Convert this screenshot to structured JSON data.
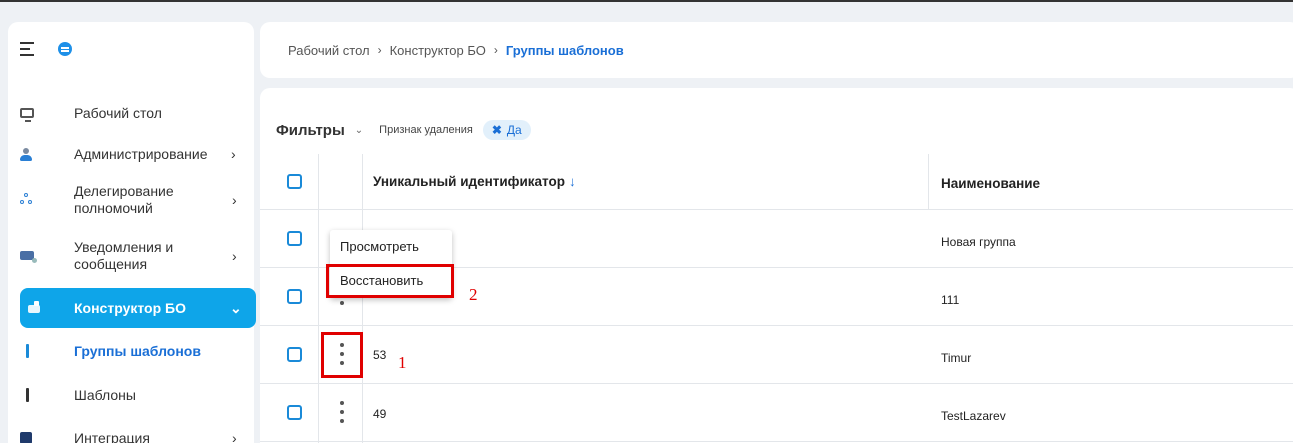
{
  "sidebar": {
    "items": [
      {
        "label": "Рабочий стол",
        "icon": "monitor-icon"
      },
      {
        "label": "Администрирование",
        "icon": "admin-icon"
      },
      {
        "label": "Делегирование полномочий",
        "line1": "Делегирование",
        "line2": "полномочий",
        "icon": "delegation-icon"
      },
      {
        "label": "Уведомления и сообщения",
        "line1": "Уведомления и",
        "line2": "сообщения",
        "icon": "mail-icon"
      },
      {
        "label": "Конструктор БО",
        "icon": "constructor-icon"
      },
      {
        "label": "Группы шаблонов",
        "icon": "bar-icon"
      },
      {
        "label": "Шаблоны",
        "icon": "bar-icon"
      },
      {
        "label": "Интеграция",
        "icon": "puzzle-icon"
      }
    ],
    "chevron": "›",
    "chevron_open": "⌄"
  },
  "breadcrumb": {
    "items": [
      "Рабочий стол",
      "Конструктор БО",
      "Группы шаблонов"
    ],
    "sep": "›"
  },
  "filters": {
    "title": "Фильтры",
    "chevron": "⌄",
    "filter_name": "Признак удаления",
    "chip_remove": "✖",
    "chip_value": "Да"
  },
  "table": {
    "columns": [
      "Уникальный идентификатор",
      "Наименование"
    ],
    "sort_arrow": "↓",
    "rows": [
      {
        "id": "",
        "name": "Новая группа"
      },
      {
        "id": "",
        "name": "111"
      },
      {
        "id": "53",
        "name": "Timur"
      },
      {
        "id": "49",
        "name": "TestLazarev"
      }
    ]
  },
  "context_menu": {
    "items": [
      "Просмотреть",
      "Восстановить"
    ]
  },
  "annotations": {
    "first": "1",
    "second": "2"
  },
  "colors": {
    "accent": "#0ea5e9",
    "link": "#1a6fd6",
    "annotation": "#e00000"
  }
}
